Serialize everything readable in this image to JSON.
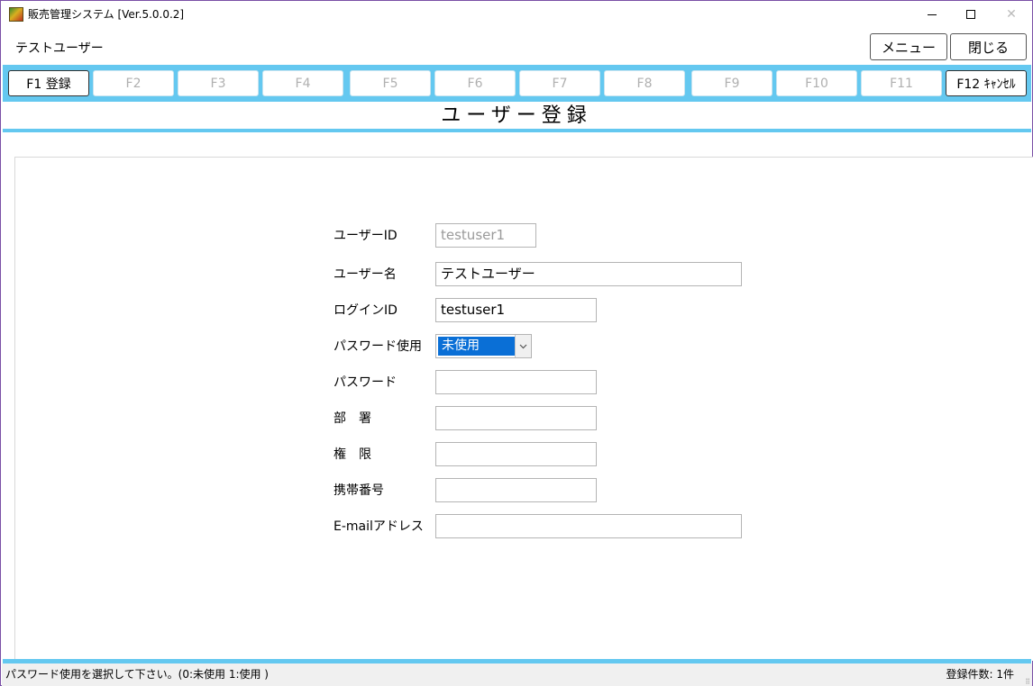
{
  "window": {
    "title": "販売管理システム [Ver.5.0.0.2]",
    "minimize_icon": "minimize-icon",
    "maximize_icon": "maximize-icon",
    "close_glyph": "✕"
  },
  "header": {
    "user_name": "テストユーザー",
    "menu_label": "メニュー",
    "close_label": "閉じる"
  },
  "fkeys": [
    {
      "label": "F1 登録",
      "enabled": true
    },
    {
      "label": "F2",
      "enabled": false
    },
    {
      "label": "F3",
      "enabled": false
    },
    {
      "label": "F4",
      "enabled": false
    },
    {
      "label": "F5",
      "enabled": false
    },
    {
      "label": "F6",
      "enabled": false
    },
    {
      "label": "F7",
      "enabled": false
    },
    {
      "label": "F8",
      "enabled": false
    },
    {
      "label": "F9",
      "enabled": false
    },
    {
      "label": "F10",
      "enabled": false
    },
    {
      "label": "F11",
      "enabled": false
    },
    {
      "label": "F12 ｷｬﾝｾﾙ",
      "enabled": true
    }
  ],
  "page": {
    "title": "ユーザー登録"
  },
  "form": {
    "user_id": {
      "label": "ユーザーID",
      "value": "testuser1",
      "enabled": false
    },
    "user_name": {
      "label": "ユーザー名",
      "value": "テストユーザー"
    },
    "login_id": {
      "label": "ログインID",
      "value": "testuser1"
    },
    "password_use": {
      "label": "パスワード使用",
      "value": "未使用"
    },
    "password": {
      "label": "パスワード",
      "value": ""
    },
    "department": {
      "label": "部　署",
      "value": ""
    },
    "permission": {
      "label": "権　限",
      "value": ""
    },
    "mobile": {
      "label": "携帯番号",
      "value": ""
    },
    "email": {
      "label": "E-mailアドレス",
      "value": ""
    }
  },
  "colors": {
    "accent": "#64c8f0",
    "selection": "#0a6fd6"
  },
  "status": {
    "message": "パスワード使用を選択して下さい。(0:未使用 1:使用 )",
    "count": "登録件数: 1件"
  }
}
